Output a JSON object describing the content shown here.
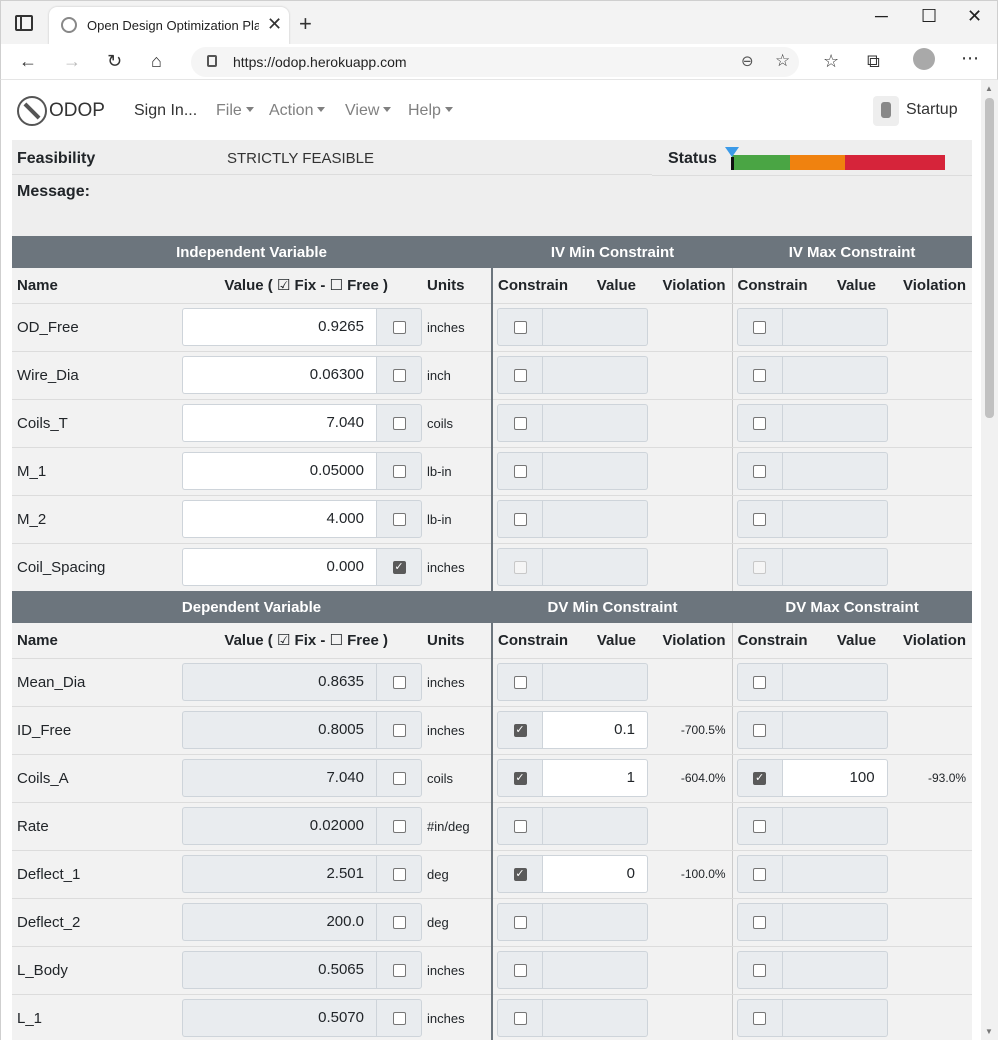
{
  "browser": {
    "tab_title": "Open Design Optimization Platfo",
    "tab_close": "✕",
    "new_tab": "+",
    "url": "https://odop.herokuapp.com",
    "icons": [
      "tab-actions-icon",
      "back-icon",
      "forward-icon",
      "refresh-icon",
      "home-icon",
      "lock-icon",
      "zoom-icon",
      "favorite-add-icon",
      "favorites-icon",
      "collections-icon",
      "profile-icon",
      "more-icon",
      "minimize-icon",
      "maximize-icon",
      "close-icon"
    ]
  },
  "app": {
    "brand": "ODOP",
    "menu": {
      "sign_in": "Sign In...",
      "file": "File",
      "action": "Action",
      "view": "View",
      "help": "Help"
    },
    "startup": "Startup"
  },
  "feasibility": {
    "label": "Feasibility",
    "value": "STRICTLY FEASIBLE",
    "status_label": "Status",
    "message_label": "Message:",
    "status_level": 0.0,
    "colors": {
      "green": "#4aa544",
      "orange": "#f0820f",
      "red": "#d6243a",
      "marker": "#3b9ae8"
    }
  },
  "iv_table": {
    "group_headers": {
      "main": "Independent Variable",
      "min": "IV Min Constraint",
      "max": "IV Max Constraint"
    },
    "columns": {
      "name": "Name",
      "value": "Value ( ☑ Fix - ☐ Free )",
      "units": "Units",
      "constrain": "Constrain",
      "cvalue": "Value",
      "violation": "Violation"
    },
    "rows": [
      {
        "name": "OD_Free",
        "value": "0.9265",
        "units": "inches"
      },
      {
        "name": "Wire_Dia",
        "value": "0.06300",
        "units": "inch"
      },
      {
        "name": "Coils_T",
        "value": "7.040",
        "units": "coils"
      },
      {
        "name": "M_1",
        "value": "0.05000",
        "units": "lb-in"
      },
      {
        "name": "M_2",
        "value": "4.000",
        "units": "lb-in"
      },
      {
        "name": "Coil_Spacing",
        "value": "0.000",
        "units": "inches"
      }
    ]
  },
  "dv_table": {
    "group_headers": {
      "main": "Dependent Variable",
      "min": "DV Min Constraint",
      "max": "DV Max Constraint"
    },
    "columns": {
      "name": "Name",
      "value": "Value ( ☑ Fix - ☐ Free )",
      "units": "Units",
      "constrain": "Constrain",
      "cvalue": "Value",
      "violation": "Violation"
    },
    "rows": [
      {
        "name": "Mean_Dia",
        "value": "0.8635",
        "units": "inches",
        "min_value": "",
        "min_violation": "",
        "max_value": "",
        "max_violation": ""
      },
      {
        "name": "ID_Free",
        "value": "0.8005",
        "units": "inches",
        "min_value": "0.1",
        "min_violation": "-700.5%",
        "max_value": "",
        "max_violation": ""
      },
      {
        "name": "Coils_A",
        "value": "7.040",
        "units": "coils",
        "min_value": "1",
        "min_violation": "-604.0%",
        "max_value": "100",
        "max_violation": "-93.0%"
      },
      {
        "name": "Rate",
        "value": "0.02000",
        "units": "#in/deg",
        "min_value": "",
        "min_violation": "",
        "max_value": "",
        "max_violation": ""
      },
      {
        "name": "Deflect_1",
        "value": "2.501",
        "units": "deg",
        "min_value": "0",
        "min_violation": "-100.0%",
        "max_value": "",
        "max_violation": ""
      },
      {
        "name": "Deflect_2",
        "value": "200.0",
        "units": "deg",
        "min_value": "",
        "min_violation": "",
        "max_value": "",
        "max_violation": ""
      },
      {
        "name": "L_Body",
        "value": "0.5065",
        "units": "inches",
        "min_value": "",
        "min_violation": "",
        "max_value": "",
        "max_violation": ""
      },
      {
        "name": "L_1",
        "value": "0.5070",
        "units": "inches",
        "min_value": "",
        "min_violation": "",
        "max_value": "",
        "max_violation": ""
      }
    ]
  }
}
